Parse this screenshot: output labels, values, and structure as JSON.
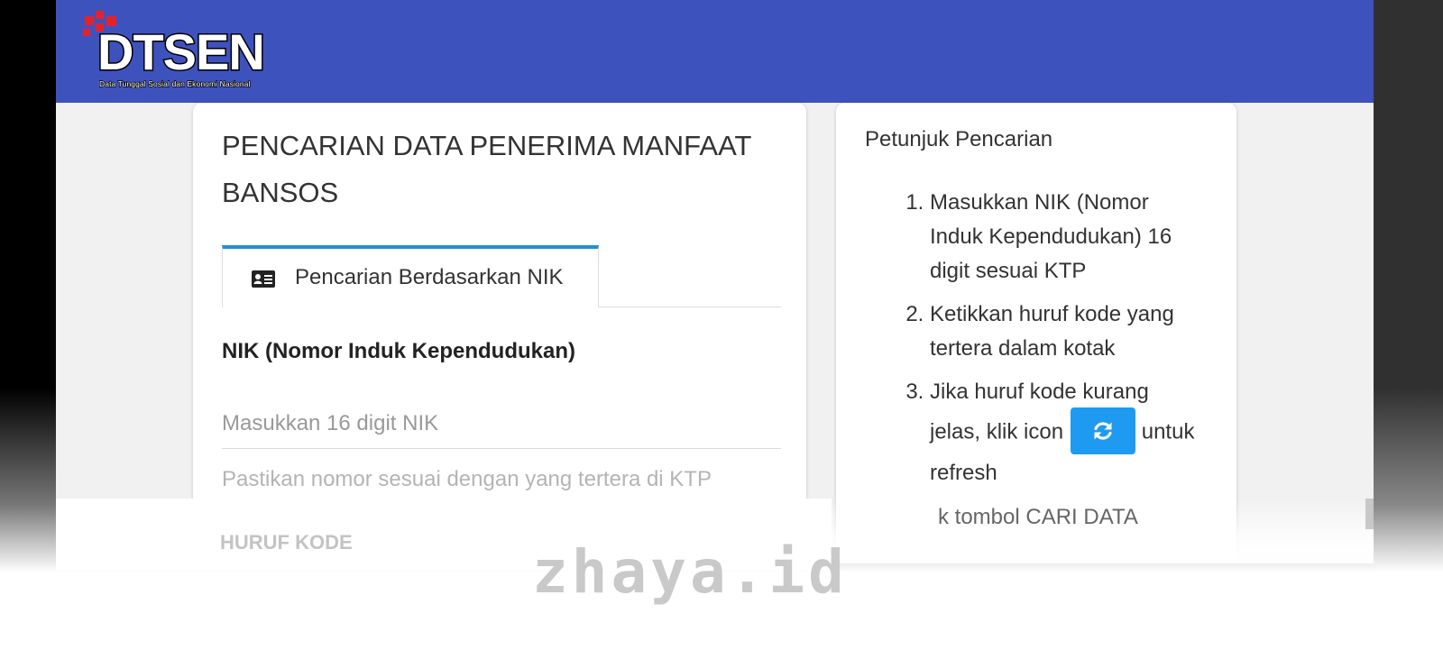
{
  "brand": {
    "name": "DTSEN",
    "tagline": "Data Tunggal Sosial dan Ekonomi Nasional",
    "header_color": "#3e52be",
    "logo_accent": "#e3232c"
  },
  "search_card": {
    "title": "PENCARIAN DATA PENERIMA MANFAAT BANSOS",
    "tab_label": "Pencarian Berdasarkan NIK",
    "tab_icon": "id-card-icon",
    "nik_label": "NIK (Nomor Induk Kependudukan)",
    "nik_placeholder": "Masukkan 16 digit NIK",
    "nik_value": "",
    "nik_hint": "Pastikan nomor sesuai dengan yang tertera di KTP",
    "kode_label": "HURUF KODE"
  },
  "guide_card": {
    "title": "Petunjuk Pencarian",
    "step1": "Masukkan NIK (Nomor Induk Kependudukan) 16 digit sesuai KTP",
    "step2": "Ketikkan huruf kode yang tertera dalam kotak",
    "step3_before": "Jika huruf kode kurang jelas, klik icon",
    "step3_after": "untuk refresh",
    "step3_icon": "refresh-icon",
    "step4_partial": "k tombol CARI DATA",
    "button_color": "#1e9bf0"
  },
  "watermark": "zhaya.id"
}
